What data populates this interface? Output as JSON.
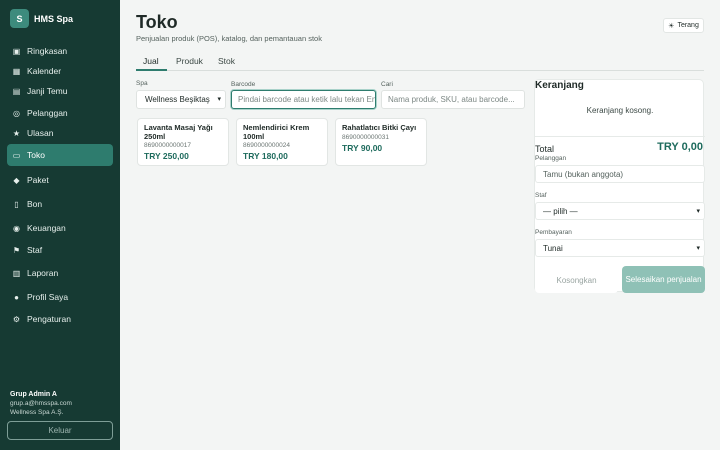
{
  "brand": {
    "logo_letter": "S",
    "name": "HMS Spa"
  },
  "nav": {
    "items": [
      {
        "icon": "▣",
        "label": "Ringkasan"
      },
      {
        "icon": "▦",
        "label": "Kalender"
      },
      {
        "icon": "▤",
        "label": "Janji Temu"
      },
      {
        "icon": "◎",
        "label": "Pelanggan"
      },
      {
        "icon": "★",
        "label": "Ulasan"
      },
      {
        "icon": "▭",
        "label": "Toko"
      },
      {
        "icon": "◆",
        "label": "Paket"
      },
      {
        "icon": "▯",
        "label": "Bon"
      },
      {
        "icon": "◉",
        "label": "Keuangan"
      },
      {
        "icon": "⚑",
        "label": "Staf"
      },
      {
        "icon": "▥",
        "label": "Laporan"
      },
      {
        "icon": "●",
        "label": "Profil Saya"
      },
      {
        "icon": "⚙",
        "label": "Pengaturan"
      }
    ],
    "active_index": 5
  },
  "user": {
    "name": "Grup Admin A",
    "email": "grup.a@hmsspa.com",
    "company": "Wellness Spa A.Ş."
  },
  "logout_label": "Keluar",
  "header": {
    "title": "Toko",
    "subtitle": "Penjualan produk (POS), katalog, dan pemantauan stok",
    "theme_label": "Terang",
    "theme_icon": "☀"
  },
  "tabs": [
    "Jual",
    "Produk",
    "Stok"
  ],
  "filters": {
    "spa_label": "Spa",
    "spa_value": "Wellness Beşiktaş",
    "barcode_label": "Barcode",
    "barcode_placeholder": "Pindai barcode atau ketik lalu tekan Enter",
    "search_label": "Cari",
    "search_placeholder": "Nama produk, SKU, atau barcode..."
  },
  "products": [
    {
      "name": "Lavanta Masaj Yağı 250ml",
      "sku": "8690000000017",
      "price": "TRY 250,00"
    },
    {
      "name": "Nemlendirici Krem 100ml",
      "sku": "8690000000024",
      "price": "TRY 180,00"
    },
    {
      "name": "Rahatlatıcı Bitki Çayı",
      "sku": "8690000000031",
      "price": "TRY 90,00"
    }
  ],
  "cart": {
    "title": "Keranjang",
    "empty_text": "Keranjang kosong.",
    "total_label": "Total",
    "total_value": "TRY 0,00",
    "customer_label": "Pelanggan",
    "customer_placeholder": "Tamu (bukan anggota)",
    "staff_label": "Staf",
    "staff_value": "— pilih —",
    "payment_label": "Pembayaran",
    "payment_value": "Tunai",
    "clear_label": "Kosongkan",
    "finish_label": "Selesaikan penjualan"
  },
  "colors": {
    "sidebar": "#163a33",
    "accent": "#2e7c6e",
    "price": "#1e6b5d"
  }
}
